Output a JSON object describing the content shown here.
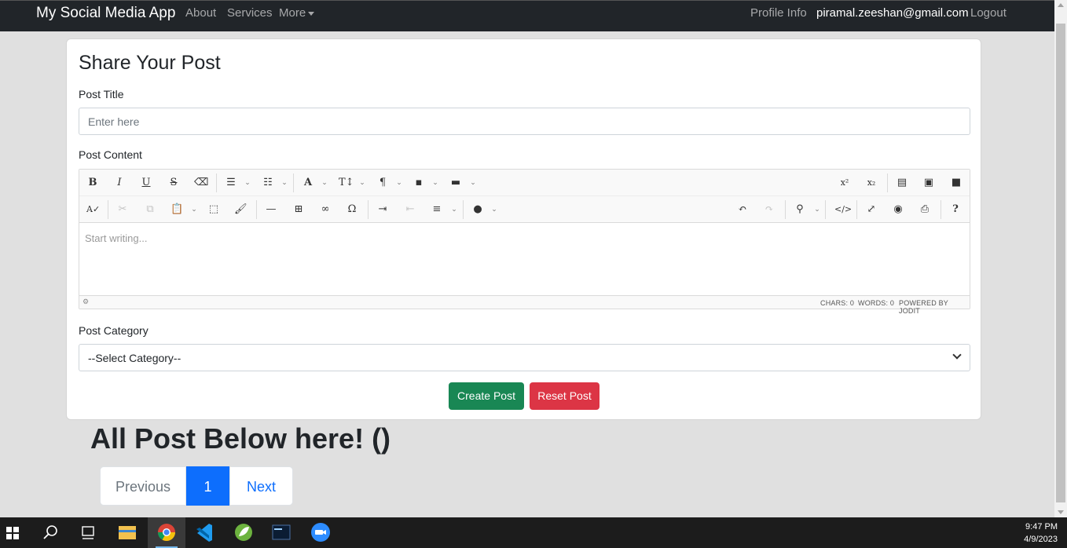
{
  "navbar": {
    "brand": "My Social Media App",
    "links": [
      "About",
      "Services",
      "More"
    ],
    "profile": "Profile Info",
    "email": "piramal.zeeshan@gmail.com",
    "logout": "Logout"
  },
  "form": {
    "title": "Share Your Post",
    "post_title_label": "Post Title",
    "post_title_placeholder": "Enter here",
    "post_content_label": "Post Content",
    "editor_placeholder": "Start writing...",
    "status_chars": "Chars: 0",
    "status_words": "Words: 0",
    "status_powered": "Powered by Jodit",
    "category_label": "Post Category",
    "category_selected": "--Select Category--",
    "create_label": "Create Post",
    "reset_label": "Reset Post"
  },
  "posts": {
    "heading": "All Post Below here! ()",
    "pagination": {
      "prev": "Previous",
      "current": "1",
      "next": "Next"
    }
  },
  "toolbar_icons": {
    "row1": [
      "bold-icon",
      "italic-icon",
      "underline-icon",
      "strikethrough-icon",
      "eraser-icon",
      "bullet-list-icon",
      "numbered-list-icon",
      "font-icon",
      "font-size-icon",
      "paragraph-icon",
      "classes-icon",
      "spacing-icon",
      "superscript-icon",
      "subscript-icon",
      "file-icon",
      "image-icon",
      "video-icon"
    ],
    "row2": [
      "spellcheck-icon",
      "cut-icon",
      "copy-icon",
      "paste-icon",
      "select-all-icon",
      "format-painter-icon",
      "horizontal-rule-icon",
      "table-icon",
      "link-icon",
      "special-char-icon",
      "indent-icon",
      "outdent-icon",
      "align-icon",
      "brush-icon",
      "undo-icon",
      "redo-icon",
      "find-icon",
      "source-icon",
      "fullsize-icon",
      "preview-icon",
      "print-icon",
      "help-icon"
    ]
  },
  "taskbar": {
    "time": "9:47 PM",
    "date": "4/9/2023",
    "apps": [
      "start-icon",
      "search-icon",
      "task-view-icon",
      "file-explorer-icon",
      "chrome-icon",
      "vscode-icon",
      "spring-icon",
      "terminal-icon",
      "zoom-icon"
    ]
  },
  "colors": {
    "navbar": "#212529",
    "success": "#198754",
    "danger": "#dc3545",
    "primary": "#0d6efd"
  }
}
